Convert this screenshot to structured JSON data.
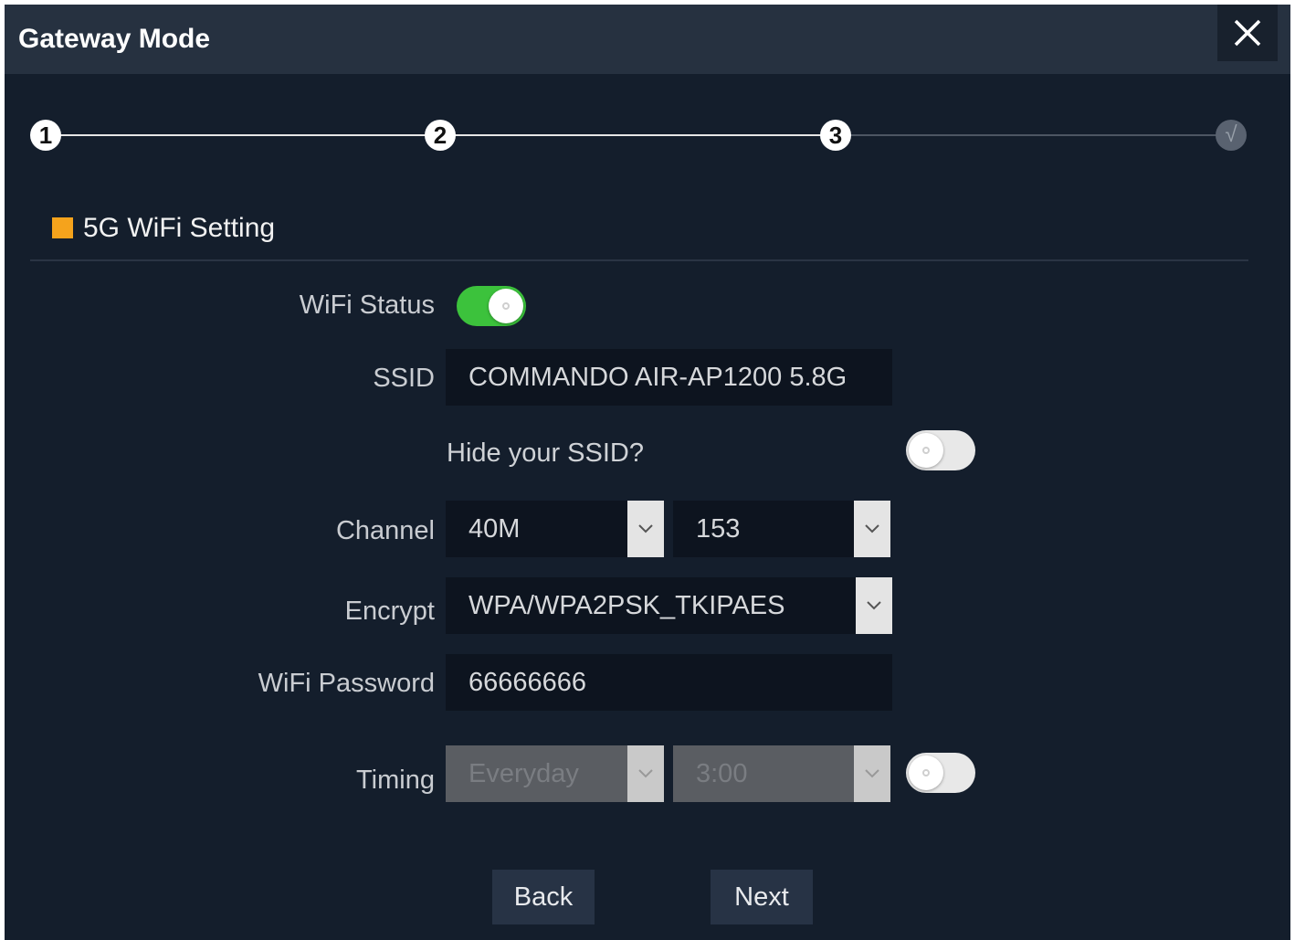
{
  "window": {
    "title": "Gateway Mode",
    "close_icon": "close-icon"
  },
  "steps": [
    {
      "label": "1"
    },
    {
      "label": "2"
    },
    {
      "label": "3"
    },
    {
      "label": "√"
    }
  ],
  "section": {
    "title": "5G WiFi Setting",
    "accent_color": "#f5a31c"
  },
  "form": {
    "wifi_status": {
      "label": "WiFi Status",
      "enabled": true
    },
    "ssid": {
      "label": "SSID",
      "value": "COMMANDO AIR-AP1200 5.8G"
    },
    "hide_ssid": {
      "label": "Hide your SSID?",
      "enabled": false
    },
    "channel": {
      "label": "Channel",
      "bandwidth": "40M",
      "channel": "153"
    },
    "encrypt": {
      "label": "Encrypt",
      "value": "WPA/WPA2PSK_TKIPAES"
    },
    "wifi_password": {
      "label": "WiFi Password",
      "value": "66666666"
    },
    "timing": {
      "label": "Timing",
      "schedule": "Everyday",
      "time": "3:00",
      "enabled": false
    }
  },
  "buttons": {
    "back": "Back",
    "next": "Next"
  },
  "colors": {
    "toggle_on": "#3cc23c",
    "background": "#141e2c",
    "header": "#263140"
  }
}
